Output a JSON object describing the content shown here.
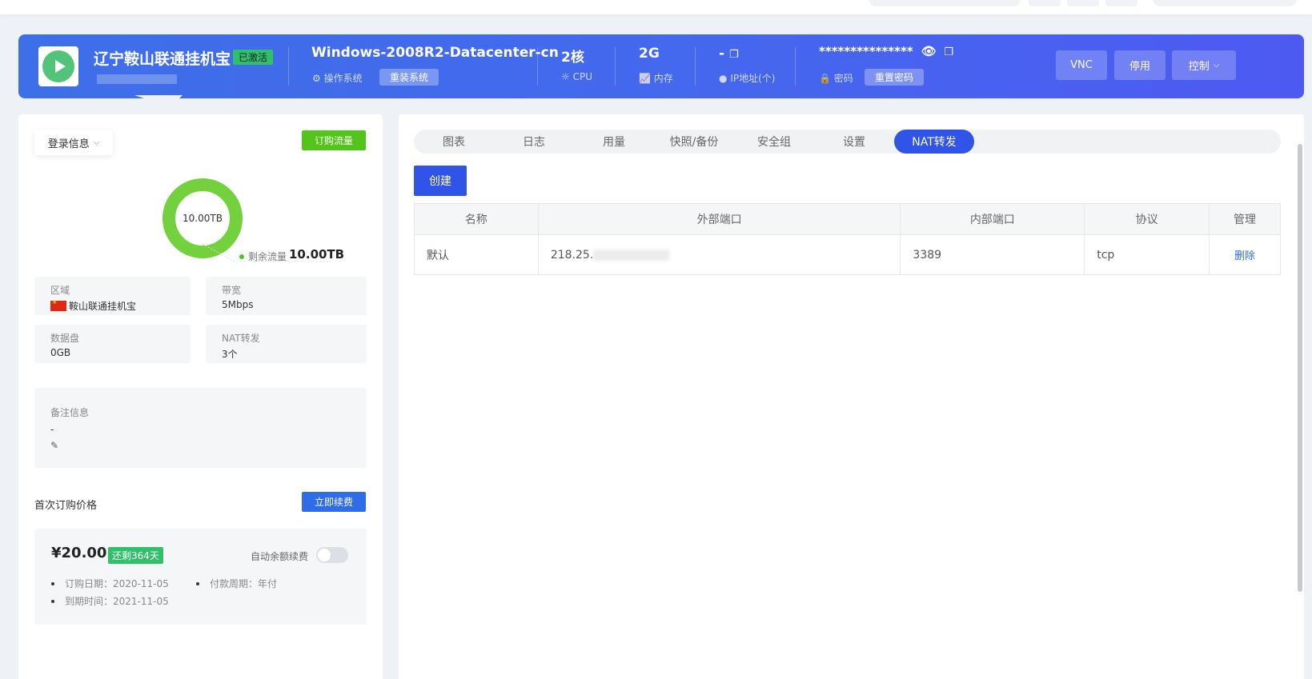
{
  "header": {
    "server_name": "辽宁鞍山联通挂机宝",
    "status_badge": "已激活",
    "os_name": "Windows-2008R2-Datacenter-cn",
    "os_label": "操作系统",
    "reinstall_label": "重装系统",
    "cpu_value": "2核",
    "cpu_label": "CPU",
    "memory_value": "2G",
    "memory_label": "内存",
    "ip_value": "-",
    "ip_label": "IP地址(个)",
    "password_masked": "***************",
    "password_label": "密码",
    "reset_password_label": "重置密码",
    "vnc_label": "VNC",
    "stop_label": "停用",
    "control_label": "控制"
  },
  "left": {
    "login_info_label": "登录信息",
    "buy_traffic_label": "订购流量",
    "traffic_total": "10.00TB",
    "traffic_remaining_label": "剩余流量",
    "traffic_remaining_value": "10.00TB",
    "traffic_fraction": 1.0,
    "region_label": "区域",
    "region_value": "鞍山联通挂机宝",
    "bandwidth_label": "带宽",
    "bandwidth_value": "5Mbps",
    "disk_label": "数据盘",
    "disk_value": "0GB",
    "nat_label": "NAT转发",
    "nat_value": "3个",
    "remark_label": "备注信息",
    "remark_value": "-",
    "first_price_label": "首次订购价格",
    "renew_label": "立即续费",
    "price": "¥20.00",
    "days_left": "还剩364天",
    "auto_renew_label": "自动余额续费",
    "order_date": "订购日期：2020-11-05",
    "pay_cycle": "付款周期：年付",
    "expire_date": "到期时间：2021-11-05"
  },
  "tabs": [
    {
      "label": "图表"
    },
    {
      "label": "日志"
    },
    {
      "label": "用量"
    },
    {
      "label": "快照/备份"
    },
    {
      "label": "安全组"
    },
    {
      "label": "设置"
    },
    {
      "label": "NAT转发"
    }
  ],
  "create_label": "创建",
  "table": {
    "headers": [
      "名称",
      "外部端口",
      "内部端口",
      "协议",
      "管理"
    ],
    "rows": [
      {
        "name": "默认",
        "external": "218.25.",
        "internal": "3389",
        "protocol": "tcp",
        "action": "删除"
      }
    ]
  },
  "colors": {
    "accent": "#3053e8",
    "success": "#52c41a",
    "badge_green": "#30c06a"
  }
}
